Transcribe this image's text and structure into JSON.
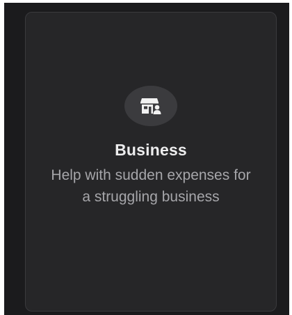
{
  "card": {
    "icon": "storefront-person-icon",
    "title": "Business",
    "description": "Help with sudden expenses for a struggling business"
  },
  "colors": {
    "background": "#1b1b1d",
    "card": "#262628",
    "icon_circle": "#3b3b3e",
    "title": "#ededee",
    "description": "#a6a6aa"
  }
}
